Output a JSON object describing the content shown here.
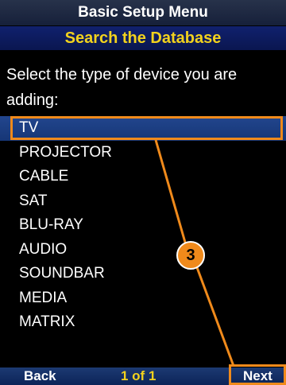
{
  "header": {
    "title": "Basic Setup Menu",
    "subtitle": "Search the Database"
  },
  "instruction": "Select the type of device you are adding:",
  "devices": [
    "TV",
    "PROJECTOR",
    "CABLE",
    "SAT",
    "BLU-RAY",
    "AUDIO",
    "SOUNDBAR",
    "MEDIA",
    "MATRIX"
  ],
  "selected_device": "TV",
  "callout": {
    "number": "3"
  },
  "footer": {
    "back_label": "Back",
    "page_indicator": "1 of 1",
    "next_label": "Next"
  },
  "colors": {
    "accent_orange": "#f08a1b",
    "title_yellow": "#f2d21d",
    "selected_blue": "#22468e"
  }
}
